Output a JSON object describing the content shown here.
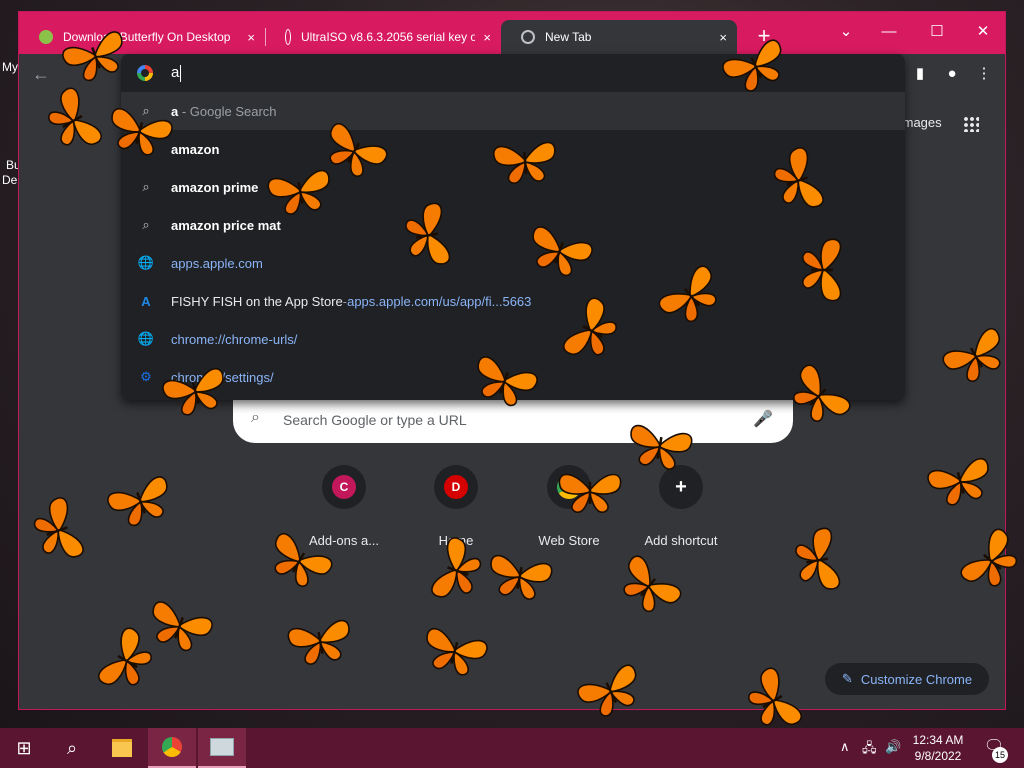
{
  "desktop": {
    "icon1_label": "My",
    "icon2_label": "Bu",
    "icon3_label": "De"
  },
  "tabs": [
    {
      "title": "Download Butterfly On Desktop",
      "close": "×"
    },
    {
      "title": "UltraISO v8.6.3.2056 serial key or",
      "close": "×"
    },
    {
      "title": "New Tab",
      "close": "×"
    }
  ],
  "newtab": "+",
  "window_controls": {
    "minimize": "—",
    "maximize": "☐",
    "close": "✕",
    "tabsearch": "⌄"
  },
  "omnibox": {
    "typed": "a",
    "suggestions": [
      {
        "icon": "search-icon",
        "glyph": "⌕",
        "main": "a",
        "suffix": " - Google Search"
      },
      {
        "icon": "search-icon",
        "glyph": "⌕",
        "main": "amazon",
        "suffix": ""
      },
      {
        "icon": "search-icon",
        "glyph": "⌕",
        "main": "amazon prime",
        "suffix": ""
      },
      {
        "icon": "search-icon",
        "glyph": "⌕",
        "main": "amazon price mat",
        "suffix": ""
      },
      {
        "icon": "globe-icon",
        "glyph": "🌐",
        "url": "apps.apple.com"
      },
      {
        "icon": "app-store-icon",
        "glyph": "A",
        "main": "FISHY FISH on the App Store",
        "sep": " - ",
        "url": "apps.apple.com/us/app/fi...5663"
      },
      {
        "icon": "globe-icon",
        "glyph": "🌐",
        "url": "chrome://chrome-urls/"
      },
      {
        "icon": "settings-icon",
        "glyph": "⚙",
        "url": "chrome://settings/"
      }
    ]
  },
  "ntp": {
    "images_link": "Images",
    "search_placeholder": "Search Google or type a URL",
    "shortcuts": [
      {
        "letter": "C",
        "label": "Add-ons a...",
        "color": "#c2185b"
      },
      {
        "letter": "D",
        "label": "Home",
        "color": "#d50000"
      },
      {
        "letter": "",
        "label": "Web Store",
        "color": "#5f6368"
      },
      {
        "letter": "+",
        "label": "Add shortcut",
        "color": "#5f6368"
      }
    ],
    "customize_label": "Customize Chrome"
  },
  "taskbar": {
    "time": "12:34 AM",
    "date": "9/8/2022",
    "notification_count": "15"
  },
  "colors": {
    "titlebar": "#d81b60",
    "taskbar": "#5a1530",
    "butterfly": "#f57c00"
  }
}
